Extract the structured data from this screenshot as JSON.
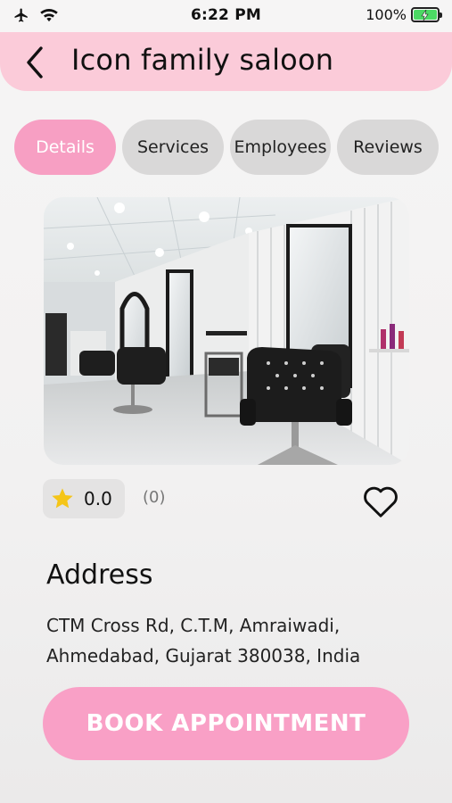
{
  "status_bar": {
    "time": "6:22 PM",
    "battery": "100%",
    "icons": [
      "airplane-icon",
      "wifi-icon",
      "battery-charging-icon"
    ]
  },
  "header": {
    "title": "Icon family saloon",
    "back_icon": "chevron-left-icon",
    "background": "#fbcbd9"
  },
  "tabs": [
    {
      "label": "Details",
      "active": true
    },
    {
      "label": "Services",
      "active": false
    },
    {
      "label": "Employees",
      "active": false
    },
    {
      "label": "Reviews",
      "active": false
    }
  ],
  "colors": {
    "accent": "#f79fc3",
    "tab_inactive": "#d9d8d8",
    "star": "#f5c518"
  },
  "details": {
    "photo_subject": "salon interior",
    "rating": "0.0",
    "review_count": "(0)",
    "favorite_icon": "heart-outline-icon",
    "address_heading": "Address",
    "address_lines": [
      "CTM Cross Rd, C.T.M, Amraiwadi,",
      "Ahmedabad, Gujarat 380038, India"
    ]
  },
  "book_button": {
    "label": "BOOK APPOINTMENT"
  }
}
